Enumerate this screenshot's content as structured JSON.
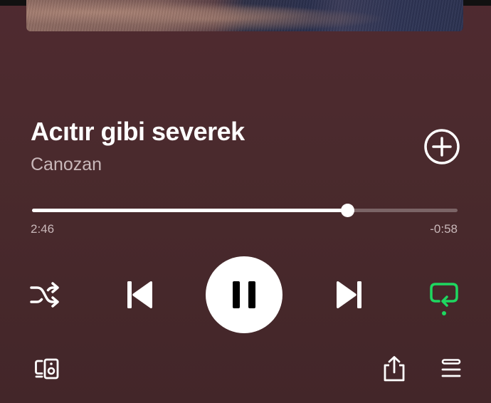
{
  "track": {
    "title": "Acıtır gibi severek",
    "artist": "Canozan"
  },
  "playback": {
    "elapsed": "2:46",
    "remaining": "-0:58",
    "progress_fraction": 0.74,
    "state": "playing",
    "repeat_active": true
  },
  "colors": {
    "accent_green": "#1ed760",
    "background": "#4a2a2d",
    "secondary_text": "#c9b8ba"
  },
  "icons": {
    "add": "plus-circle-icon",
    "shuffle": "shuffle-icon",
    "previous": "skip-previous-icon",
    "pause": "pause-icon",
    "next": "skip-next-icon",
    "repeat": "repeat-icon",
    "devices": "connect-devices-icon",
    "share": "share-icon",
    "queue": "queue-icon"
  }
}
